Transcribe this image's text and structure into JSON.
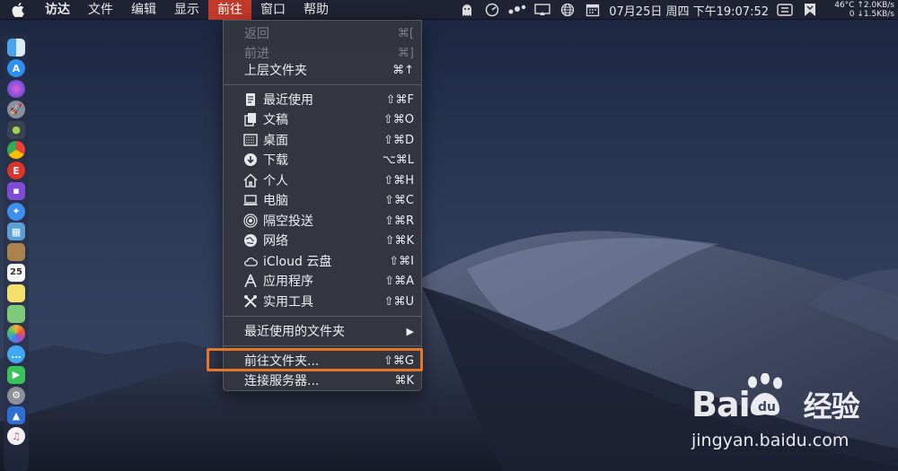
{
  "menubar": {
    "app_name": "访达",
    "menus": [
      "文件",
      "编辑",
      "显示",
      "前往",
      "窗口",
      "帮助"
    ],
    "active_menu_index": 3,
    "clock": "07月25日 周四 下午19:07:52",
    "temperature": "46°C",
    "net_up": "↑2.0KB/s",
    "net_down_prefix": "0",
    "net_down": "↓1.5KB/s"
  },
  "go_menu": {
    "items": [
      {
        "label": "返回",
        "shortcut": "⌘[",
        "disabled": true,
        "icon": ""
      },
      {
        "label": "前进",
        "shortcut": "⌘]",
        "disabled": true,
        "icon": ""
      },
      {
        "label": "上层文件夹",
        "shortcut": "⌘↑",
        "disabled": false,
        "icon": ""
      },
      {
        "label": "最近使用",
        "shortcut": "⇧⌘F",
        "disabled": false,
        "icon": "recents-icon"
      },
      {
        "label": "文稿",
        "shortcut": "⇧⌘O",
        "disabled": false,
        "icon": "documents-icon"
      },
      {
        "label": "桌面",
        "shortcut": "⇧⌘D",
        "disabled": false,
        "icon": "desktop-icon"
      },
      {
        "label": "下载",
        "shortcut": "⌥⌘L",
        "disabled": false,
        "icon": "downloads-icon"
      },
      {
        "label": "个人",
        "shortcut": "⇧⌘H",
        "disabled": false,
        "icon": "home-icon"
      },
      {
        "label": "电脑",
        "shortcut": "⇧⌘C",
        "disabled": false,
        "icon": "computer-icon"
      },
      {
        "label": "隔空投送",
        "shortcut": "⇧⌘R",
        "disabled": false,
        "icon": "airdrop-icon"
      },
      {
        "label": "网络",
        "shortcut": "⇧⌘K",
        "disabled": false,
        "icon": "network-icon"
      },
      {
        "label": "iCloud 云盘",
        "shortcut": "⇧⌘I",
        "disabled": false,
        "icon": "icloud-icon"
      },
      {
        "label": "应用程序",
        "shortcut": "⇧⌘A",
        "disabled": false,
        "icon": "applications-icon"
      },
      {
        "label": "实用工具",
        "shortcut": "⇧⌘U",
        "disabled": false,
        "icon": "utilities-icon"
      },
      {
        "label": "最近使用的文件夹",
        "shortcut": "▶",
        "disabled": false,
        "icon": ""
      },
      {
        "label": "前往文件夹...",
        "shortcut": "⇧⌘G",
        "disabled": false,
        "icon": ""
      },
      {
        "label": "连接服务器...",
        "shortcut": "⌘K",
        "disabled": false,
        "icon": ""
      }
    ]
  },
  "watermark": {
    "brand": "Bai",
    "brand_suffix": "经验",
    "url": "jingyan.baidu.com"
  },
  "colors": {
    "active_menu": "#c0392b",
    "highlight_box": "#e5762a",
    "menu_bg": "#34363e"
  }
}
